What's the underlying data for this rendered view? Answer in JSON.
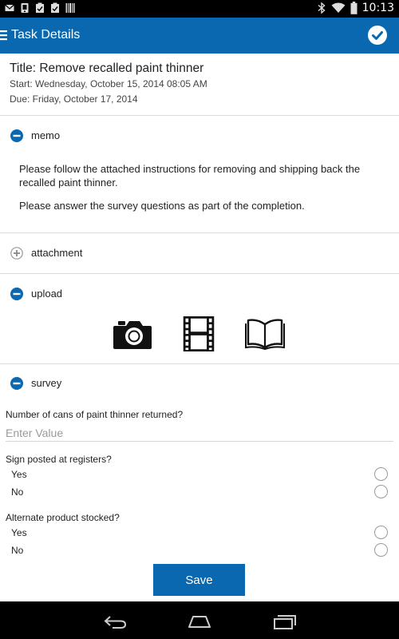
{
  "status_bar": {
    "time": "10:13",
    "left_icons": [
      "mail-icon",
      "download-icon",
      "clipboard-check-icon",
      "clipboard-check-icon",
      "barcode-icon"
    ],
    "right_icons": [
      "bluetooth-icon",
      "wifi-icon",
      "battery-icon"
    ]
  },
  "action_bar": {
    "title": "Task Details",
    "menu_icon": "menu-icon",
    "confirm_icon": "check-circle-icon"
  },
  "task": {
    "title": "Title: Remove recalled paint thinner",
    "start": "Start: Wednesday, October 15, 2014 08:05 AM",
    "due": "Due: Friday, October 17, 2014"
  },
  "sections": {
    "memo": {
      "label": "memo",
      "expanded": true,
      "paragraphs": [
        "Please follow the attached instructions for removing and shipping back the recalled paint thinner.",
        "Please answer the survey questions as part of the completion."
      ]
    },
    "attachment": {
      "label": "attachment",
      "expanded": false
    },
    "upload": {
      "label": "upload",
      "expanded": true,
      "options": [
        "camera-icon",
        "film-icon",
        "book-icon"
      ]
    },
    "survey": {
      "label": "survey",
      "expanded": true,
      "questions": [
        {
          "label": "Number of cans of paint thinner returned?",
          "placeholder": "Enter Value",
          "value": ""
        },
        {
          "label": "Sign posted at registers?",
          "options": [
            "Yes",
            "No"
          ],
          "selected": null
        },
        {
          "label": "Alternate product stocked?",
          "options": [
            "Yes",
            "No"
          ],
          "selected": null
        }
      ]
    }
  },
  "save_label": "Save",
  "nav": [
    "back-icon",
    "home-icon",
    "recent-apps-icon"
  ],
  "colors": {
    "primary": "#0a68b0",
    "status_bar": "#000000",
    "divider": "#dcdcdc"
  }
}
